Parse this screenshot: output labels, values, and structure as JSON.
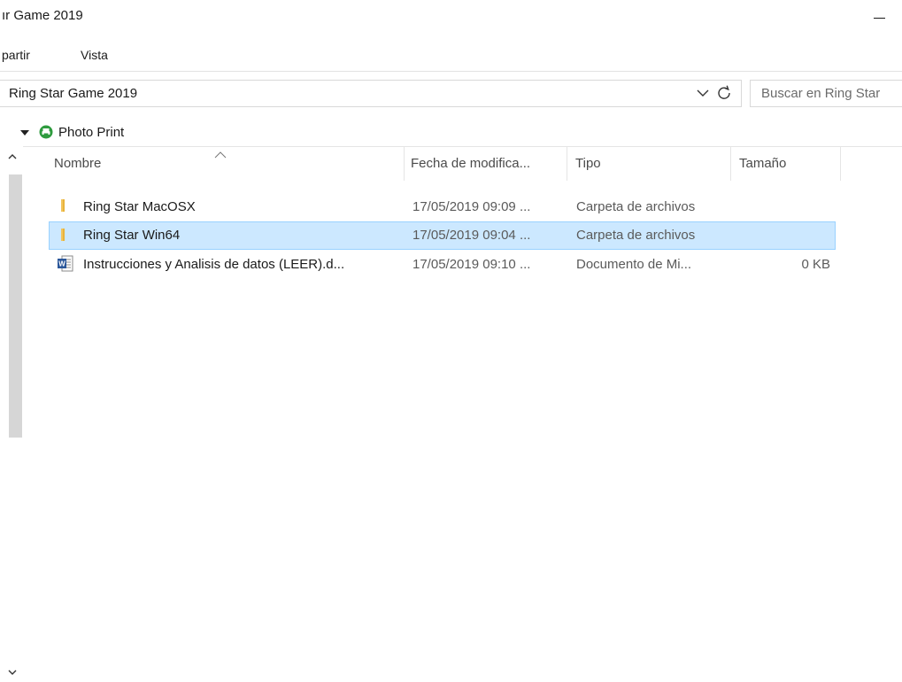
{
  "window": {
    "title": "ır Game 2019"
  },
  "ribbon": {
    "tabs": [
      {
        "label": "partir"
      },
      {
        "label": "Vista"
      }
    ]
  },
  "address_bar": {
    "path": "Ring Star Game 2019",
    "chevron_icon": "chevron-down-icon",
    "refresh_icon": "refresh-icon"
  },
  "search": {
    "placeholder": "Buscar en Ring Star"
  },
  "nav_pane": {
    "item_label": "Photo Print",
    "item_icon": "photo-print-icon"
  },
  "columns": [
    {
      "label": "Nombre"
    },
    {
      "label": "Fecha de modifica..."
    },
    {
      "label": "Tipo"
    },
    {
      "label": "Tamaño"
    }
  ],
  "files": [
    {
      "name": "Ring Star MacOSX",
      "date": "17/05/2019 09:09 ...",
      "type": "Carpeta de archivos",
      "size": "",
      "icon": "folder-icon",
      "selected": false
    },
    {
      "name": "Ring Star Win64",
      "date": "17/05/2019 09:04 ...",
      "type": "Carpeta de archivos",
      "size": "",
      "icon": "folder-icon",
      "selected": true
    },
    {
      "name": "Instrucciones y Analisis de datos (LEER).d...",
      "date": "17/05/2019 09:10 ...",
      "type": "Documento de Mi...",
      "size": "0 KB",
      "icon": "word-document-icon",
      "selected": false
    }
  ],
  "colors": {
    "selection_bg": "#cce8ff",
    "selection_border": "#99d1ff",
    "folder": "#f2c55c",
    "word_blue": "#2b579a",
    "photo_print_green": "#2e9b3e"
  }
}
